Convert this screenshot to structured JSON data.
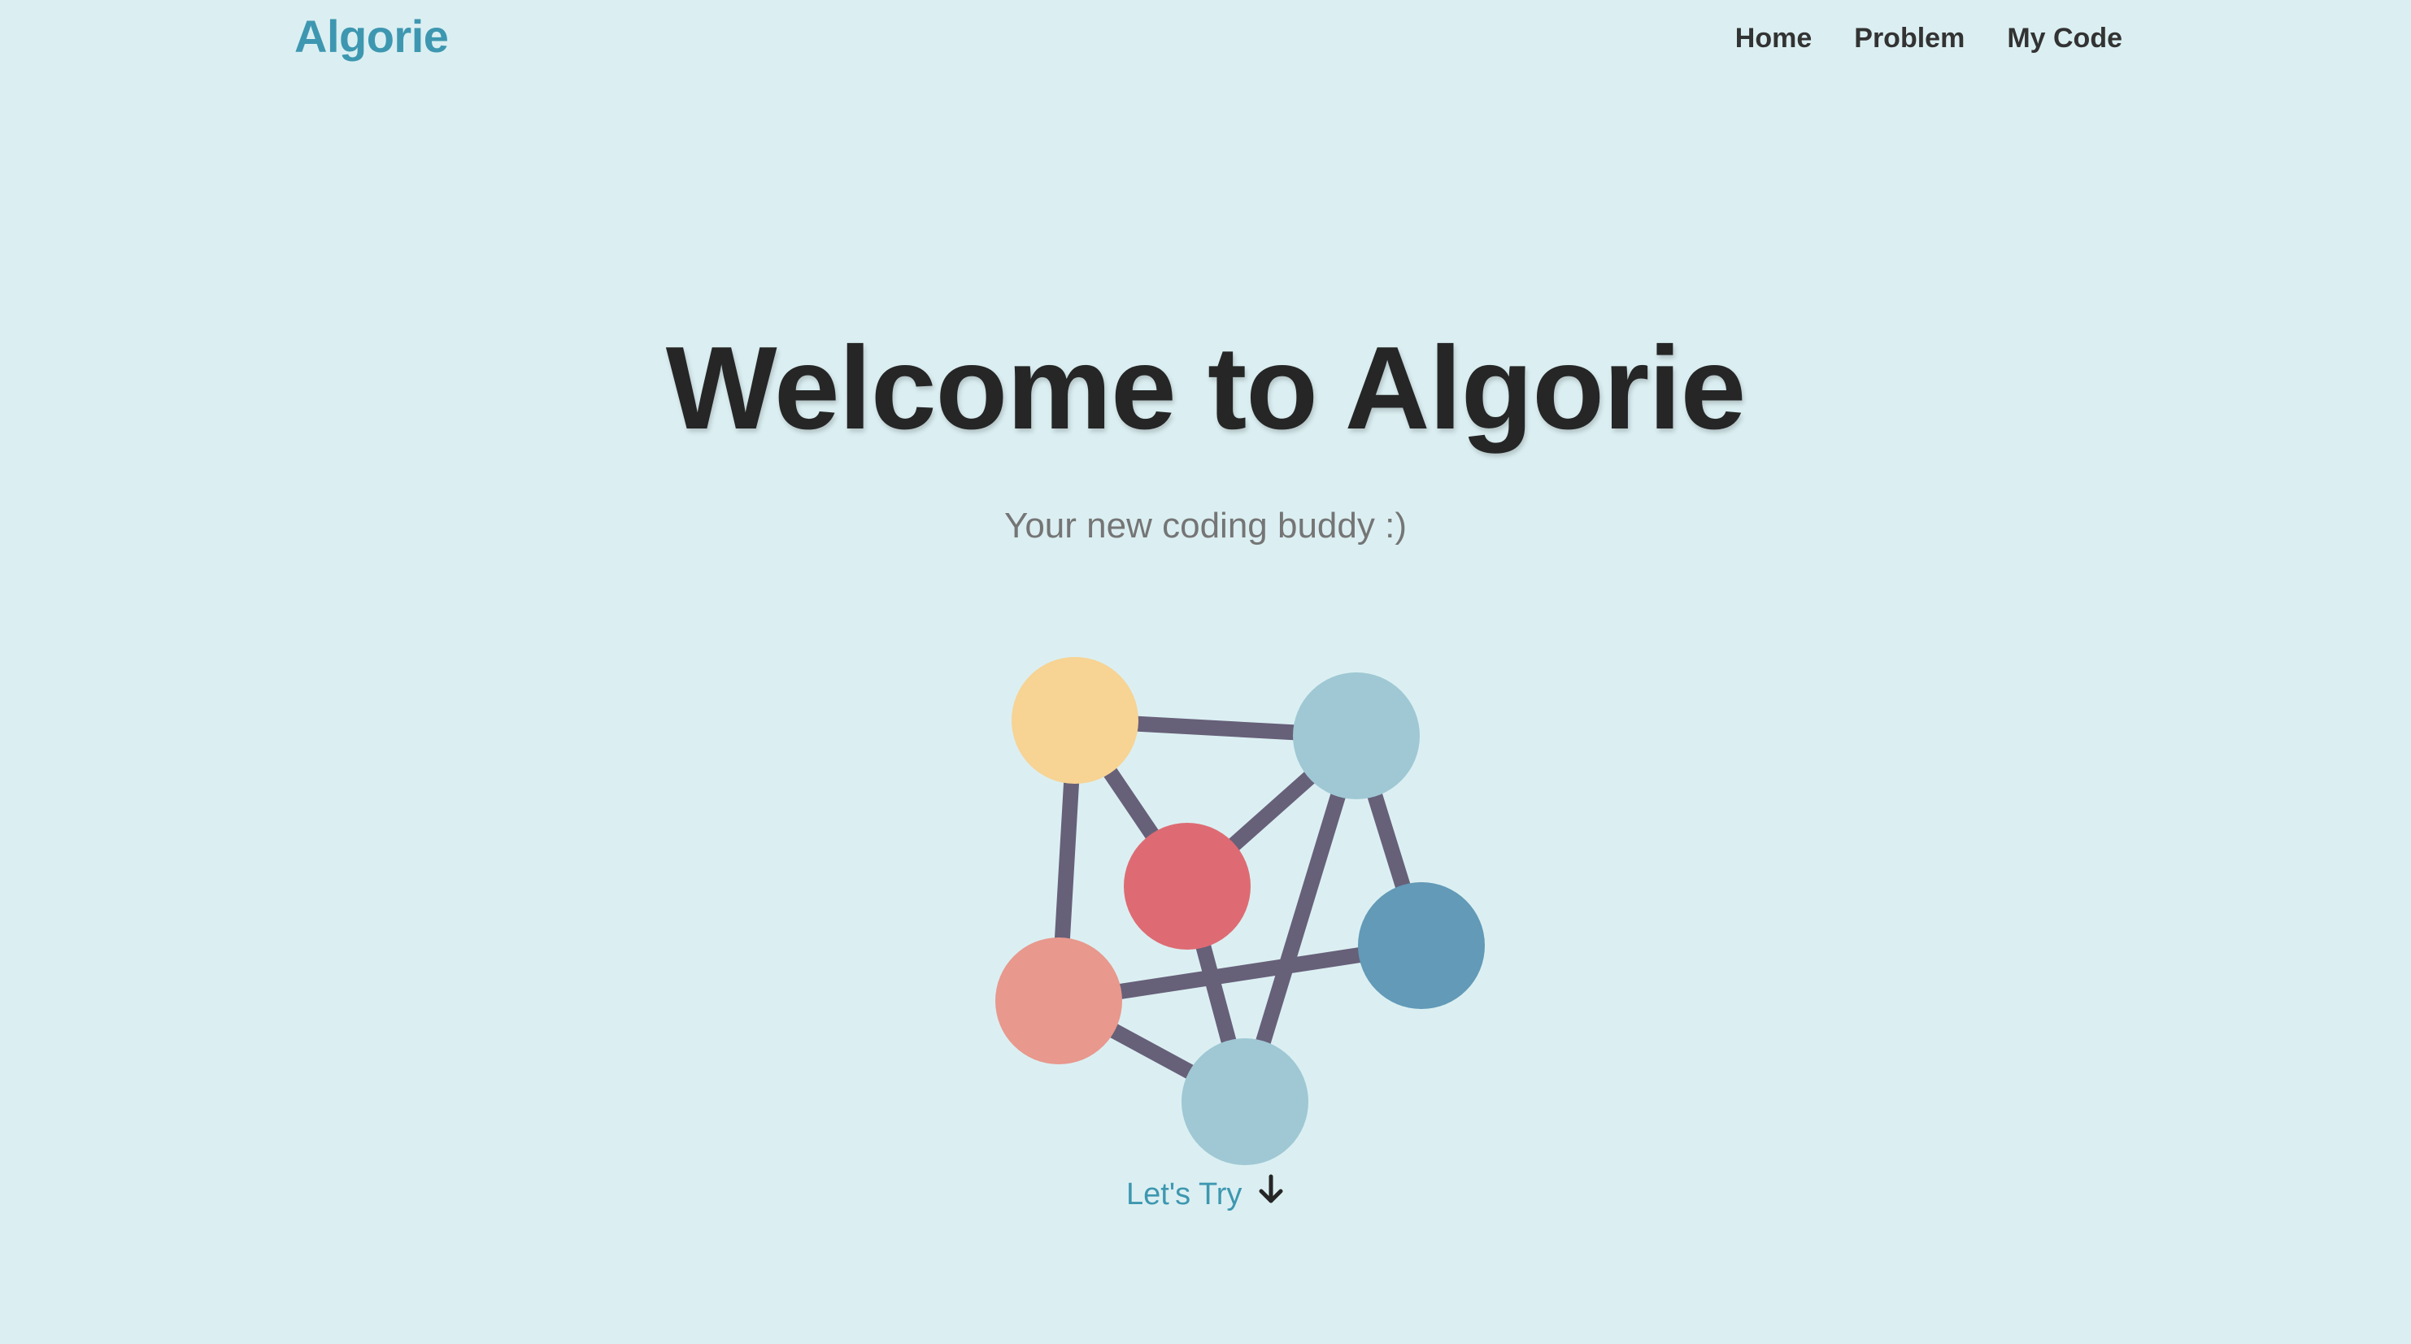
{
  "navbar": {
    "brand": "Algorie",
    "links": [
      "Home",
      "Problem",
      "My Code"
    ]
  },
  "hero": {
    "title": "Welcome to Algorie",
    "subtitle": "Your new coding buddy :)",
    "cta_label": "Let's Try"
  },
  "colors": {
    "background": "#dbeff2",
    "brand": "#3e97b0",
    "edge": "#676079",
    "node_yellow": "#f7d394",
    "node_light_blue": "#9fc8d4",
    "node_red": "#de6b73",
    "node_salmon": "#e8988d",
    "node_steel_blue": "#629ab7"
  },
  "icons": {
    "cta": "arrow-down-icon"
  }
}
